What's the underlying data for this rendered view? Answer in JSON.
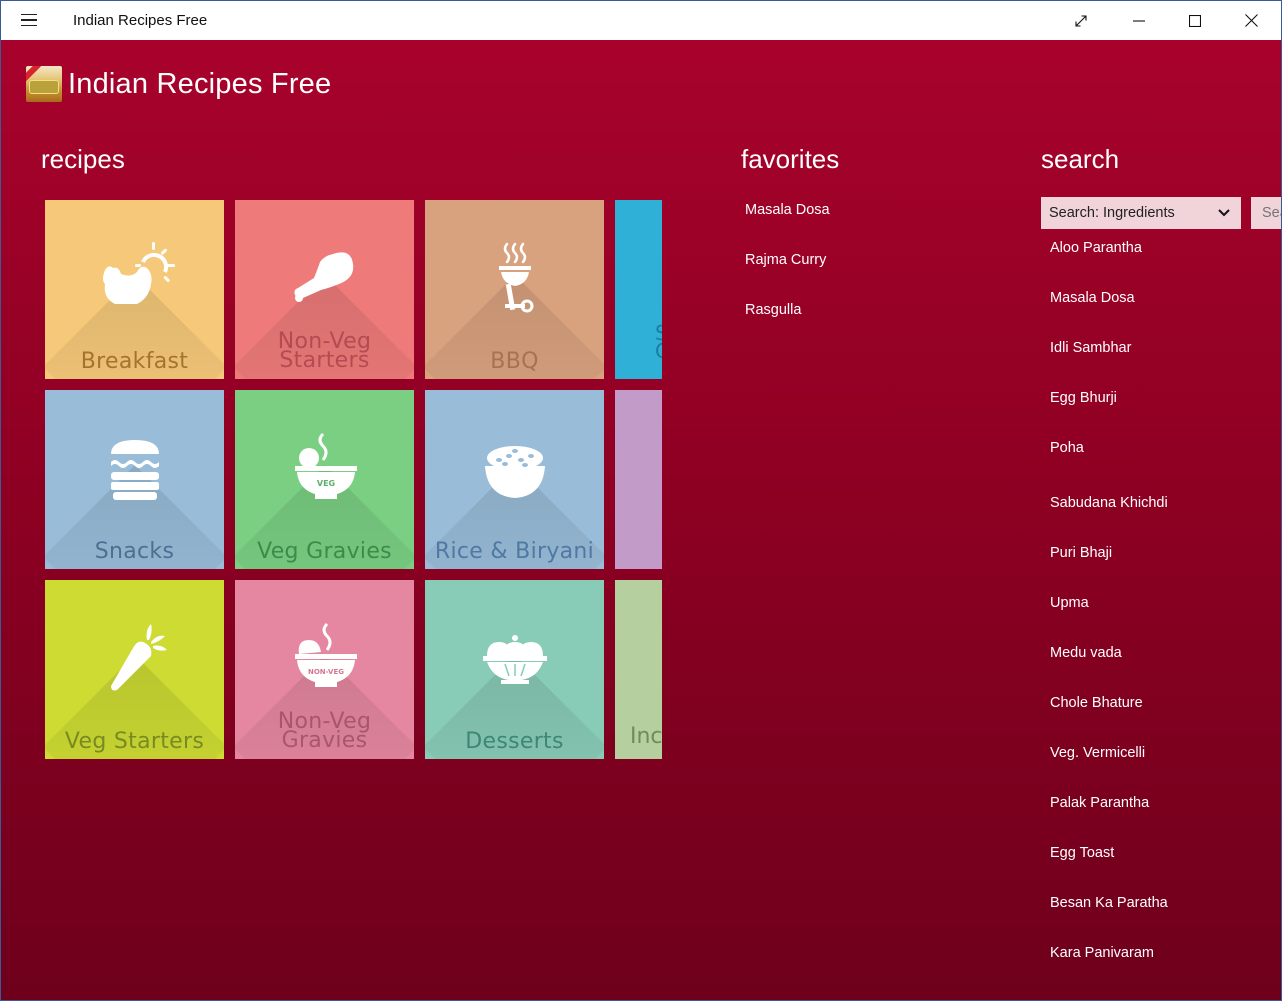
{
  "window": {
    "title": "Indian Recipes Free",
    "controls": [
      "full-screen",
      "minimize",
      "maximize",
      "close"
    ]
  },
  "header": {
    "app_name": "Indian Recipes Free",
    "logo": "indian-recipes-logo"
  },
  "sections": {
    "recipes_title": "recipes",
    "favorites_title": "favorites",
    "search_title": "search"
  },
  "tiles": [
    {
      "label": "Breakfast",
      "icon": "breakfast-hen-sun-icon",
      "bg": "#f6c97a",
      "fg": "#a4742c"
    },
    {
      "label": "Non-Veg Starters",
      "line1": "Non-Veg",
      "line2": "Starters",
      "icon": "chicken-leg-icon",
      "bg": "#ee7b7a",
      "fg": "#b54b52"
    },
    {
      "label": "BBQ",
      "icon": "bbq-grill-icon",
      "bg": "#d9a27f",
      "fg": "#a7724f"
    },
    {
      "label": "S... C...",
      "icon": "",
      "bg": "#2fb0d6",
      "fg": "#1b7da0"
    },
    {
      "label": "Snacks",
      "icon": "burger-icon",
      "bg": "#99bcd8",
      "fg": "#4c6f94"
    },
    {
      "label": "Veg Gravies",
      "icon": "veg-bowl-icon",
      "bg": "#7acf83",
      "fg": "#3c8b4b"
    },
    {
      "label": "Rice & Biryani",
      "icon": "rice-bowl-icon",
      "bg": "#99bcd8",
      "fg": "#4f79a4"
    },
    {
      "label": "",
      "icon": "",
      "bg": "#c39bc9",
      "fg": "#8a5f93"
    },
    {
      "label": "Veg Starters",
      "icon": "carrot-icon",
      "bg": "#cddb33",
      "fg": "#7a8a22"
    },
    {
      "label": "Non-Veg Gravies",
      "line1": "Non-Veg",
      "line2": "Gravies",
      "icon": "nonveg-bowl-icon",
      "bg": "#e587a1",
      "fg": "#a9566d"
    },
    {
      "label": "Desserts",
      "icon": "dessert-bowl-icon",
      "bg": "#88cbb6",
      "fg": "#3e8772"
    },
    {
      "label": "Ind...",
      "icon": "",
      "bg": "#b5cf9f",
      "fg": "#6f8c5a"
    }
  ],
  "tile_partial_labels": {
    "col4_row1": "S\nC",
    "col4_row3": "Inc"
  },
  "tile_badges": {
    "veg": "VEG",
    "nonveg": "NON-VEG"
  },
  "favorites": [
    "Masala Dosa",
    "Rajma Curry",
    "Rasgulla"
  ],
  "search": {
    "selected_option": "Search: Ingredients",
    "input_placeholder": "Search",
    "results": [
      "Aloo Parantha",
      "Masala Dosa",
      "Idli Sambhar",
      "Egg Bhurji",
      "Poha",
      "Sabudana Khichdi",
      "Puri Bhaji",
      "Upma",
      "Medu vada",
      "Chole Bhature",
      "Veg. Vermicelli",
      "Palak Parantha",
      "Egg Toast",
      "Besan Ka Paratha",
      "Kara Panivaram"
    ]
  }
}
